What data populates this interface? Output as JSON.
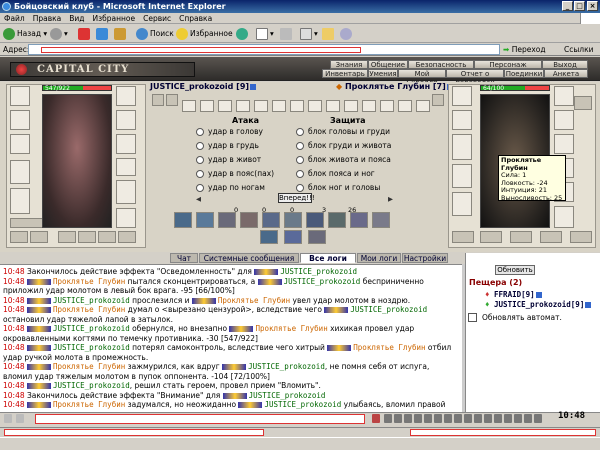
{
  "window": {
    "title": "Бойцовский клуб - Microsoft Internet Explorer"
  },
  "menu": [
    "Файл",
    "Правка",
    "Вид",
    "Избранное",
    "Сервис",
    "Справка"
  ],
  "toolbar": {
    "back": "Назад",
    "search": "Поиск",
    "favorites": "Избранное"
  },
  "address": {
    "label": "Адрес:",
    "go": "Переход",
    "links": "Ссылки"
  },
  "game": {
    "logo": "CAPITAL CITY",
    "nav_top": [
      "Знания",
      "Общение",
      "Безопасность",
      "Персонаж",
      "Выход"
    ],
    "nav_bottom": [
      "Инвентарь",
      "Умения",
      "Мой Скроллп",
      "Отчет о переводах",
      "Поединки",
      "Анкета"
    ]
  },
  "player": {
    "name": "JUSTICE_prokozoid [9]",
    "hp": "547/922",
    "hp_fraction": 0.59
  },
  "enemy": {
    "name": "Проклятье Глубин [7]",
    "hp": "64/100",
    "hp_fraction": 0.64
  },
  "battle": {
    "attack_header": "Атака",
    "defense_header": "Защита",
    "attacks": [
      "удар в голову",
      "удар в грудь",
      "удар в живот",
      "удар в пояс(пах)",
      "удар по ногам"
    ],
    "defenses": [
      "блок головы и груди",
      "блок груди и живота",
      "блок живота и пояса",
      "блок пояса и ног",
      "блок ног и головы"
    ],
    "go": "Вперед!!!",
    "counters": [
      "0",
      "0",
      "0",
      "3",
      "26"
    ]
  },
  "tooltip": {
    "name": "Проклятье Глубин",
    "lines": [
      "Сила: 1",
      "Ловкость: -24",
      "Интуиция: 21",
      "Выносливость: 25"
    ]
  },
  "tabs": [
    "Чат",
    "Системные сообщения",
    "Все логи",
    "Мои логи",
    "Настройки"
  ],
  "chat": [
    {
      "t": "10:48",
      "parts": [
        [
          "",
          " Закончилось действие эффекта \"Осведомленность\" для "
        ],
        [
          "nm",
          "JUSTICE_prokozoid"
        ]
      ]
    },
    {
      "t": "10:48",
      "parts": [
        [
          "op",
          "Проклятье Глубин"
        ],
        [
          "",
          " пытался сконцентрироваться, а "
        ],
        [
          "nm",
          "JUSTICE_prokozoid"
        ],
        [
          "",
          " бесприниченно"
        ]
      ]
    },
    {
      "t": "",
      "parts": [
        [
          "",
          "приложил удар молотом в левый бок врага. -95 [66/100%]"
        ]
      ]
    },
    {
      "t": "10:48",
      "parts": [
        [
          "nm",
          "JUSTICE_prokozoid"
        ],
        [
          "",
          " прослезился и "
        ],
        [
          "op",
          "Проклятье Глубин"
        ],
        [
          "",
          " увел удар молотом в ноздрю."
        ]
      ]
    },
    {
      "t": "10:48",
      "parts": [
        [
          "op",
          "Проклятье Глубин"
        ],
        [
          "",
          " думал о <вырезано цензурой>, вследствие чего "
        ],
        [
          "nm",
          "JUSTICE_prokozoid"
        ]
      ]
    },
    {
      "t": "",
      "parts": [
        [
          "",
          "остановил удар тяжелой лапой в затылок."
        ]
      ]
    },
    {
      "t": "10:48",
      "parts": [
        [
          "nm",
          "JUSTICE_prokozoid"
        ],
        [
          "",
          " обернулся, но внезапно "
        ],
        [
          "op",
          "Проклятье Глубин"
        ],
        [
          "",
          " хихикая провел удар"
        ]
      ]
    },
    {
      "t": "",
      "parts": [
        [
          "",
          "окровавленными когтями по темечку противника. -30 [547/922]"
        ]
      ]
    },
    {
      "t": "10:48",
      "parts": [
        [
          "nm",
          "JUSTICE_prokozoid"
        ],
        [
          "",
          " потерял самоконтроль, вследствие чего хитрый "
        ],
        [
          "op",
          "Проклятье Глубин"
        ],
        [
          "",
          " отбил"
        ]
      ]
    },
    {
      "t": "",
      "parts": [
        [
          "",
          "удар ручкой молота в промежность."
        ]
      ]
    },
    {
      "t": "10:48",
      "parts": [
        [
          "op",
          "Проклятье Глубин"
        ],
        [
          "",
          " зажмурился, как вдруг "
        ],
        [
          "nm",
          "JUSTICE_prokozoid"
        ],
        [
          "",
          ", не помня себя от испуга,"
        ]
      ]
    },
    {
      "t": "",
      "parts": [
        [
          "",
          "вломил удар тяжелым молотом в пупок оппонента. -104 [72/100%]"
        ]
      ]
    },
    {
      "t": "10:48",
      "parts": [
        [
          "nm",
          "JUSTICE_prokozoid"
        ],
        [
          "",
          ", решил стать героем, провел прием \"Вломить\"."
        ]
      ]
    },
    {
      "t": "10:48",
      "parts": [
        [
          "",
          " Закончилось действие эффекта \"Внимание\" для "
        ],
        [
          "nm",
          "JUSTICE_prokozoid"
        ]
      ]
    },
    {
      "t": "10:48",
      "parts": [
        [
          "op",
          "Проклятье Глубин"
        ],
        [
          "",
          " задумался, но неожиданно "
        ],
        [
          "nm",
          "JUSTICE_prokozoid"
        ],
        [
          "",
          " улыбаясь, вломил правой"
        ]
      ]
    }
  ],
  "right_panel": {
    "refresh": "Обновить",
    "cave": "Пещера (2)",
    "players": [
      "FFRAID[9]",
      "JUSTICE_prokozoid[9]"
    ],
    "auto": "Обновлять автомат."
  },
  "clock": "10:48"
}
